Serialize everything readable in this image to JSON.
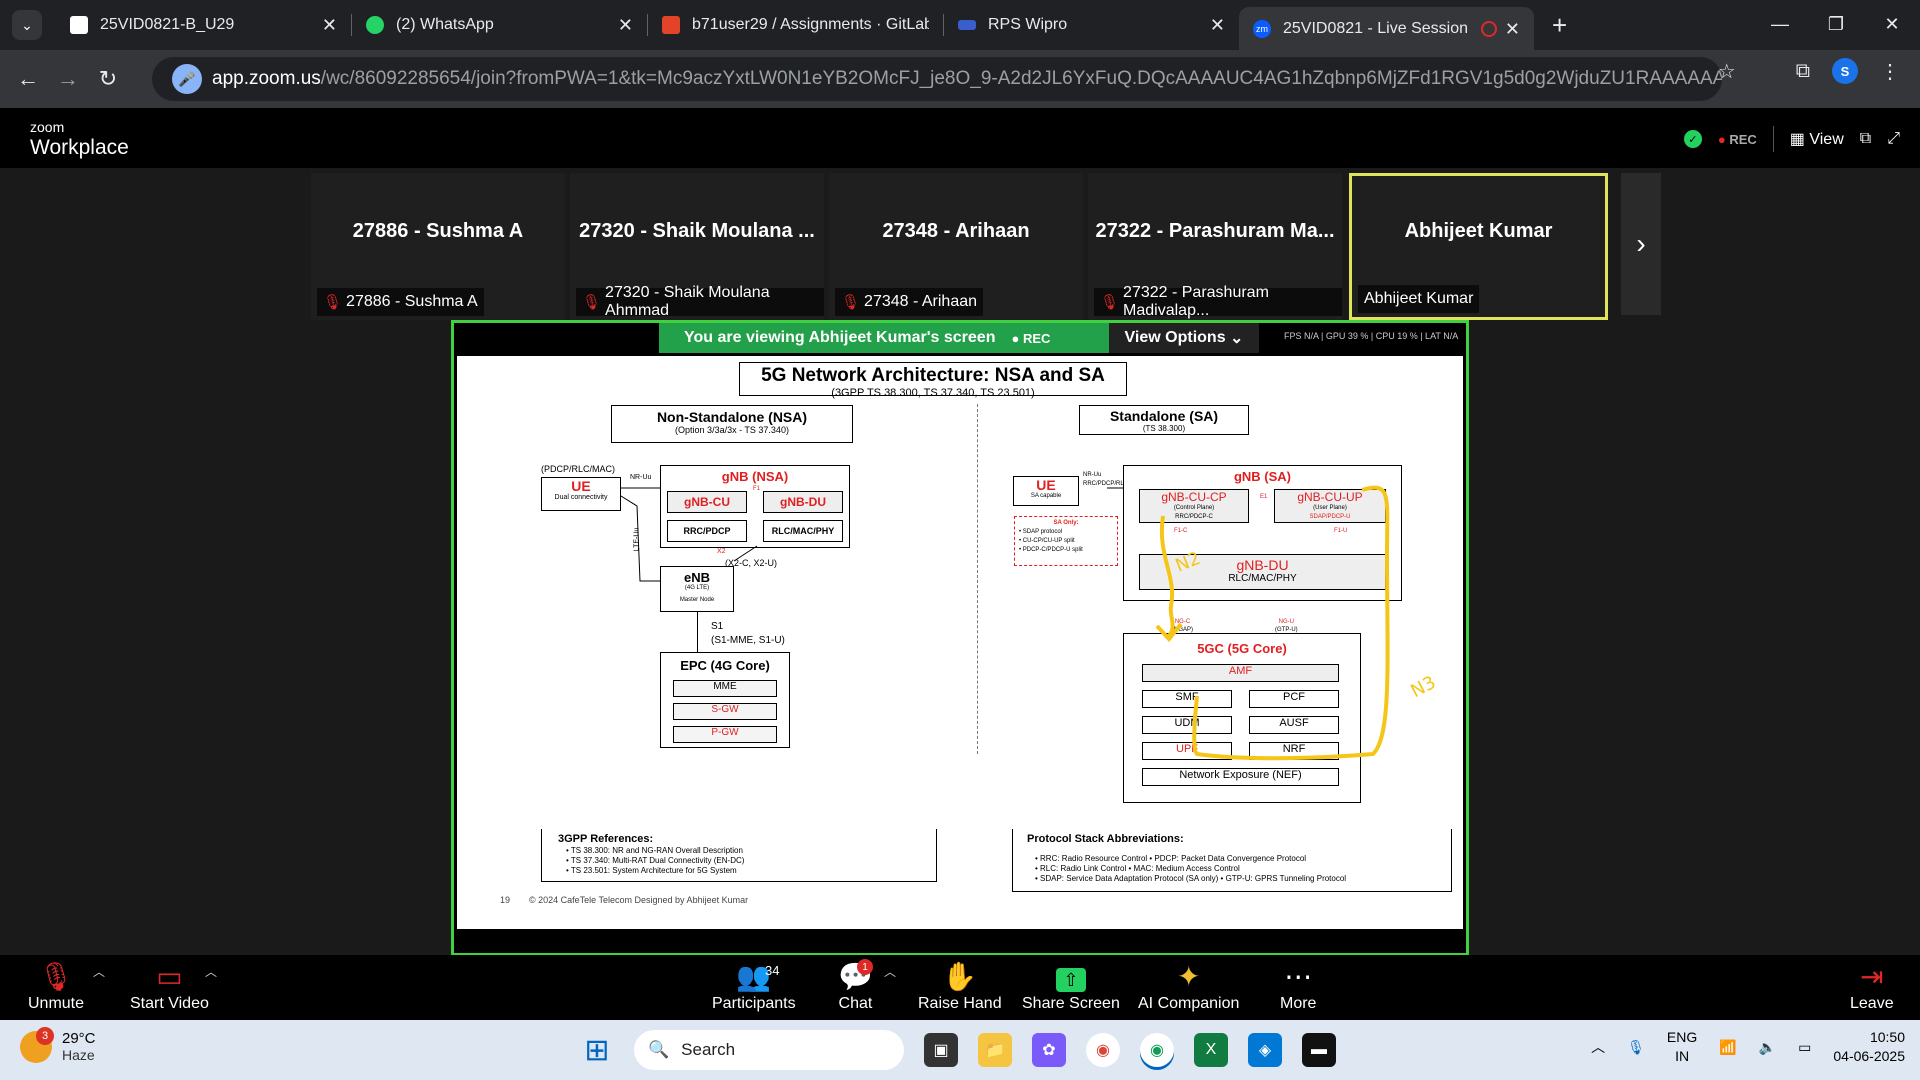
{
  "browser": {
    "tabs": [
      {
        "label": "25VID0821-B_U29"
      },
      {
        "label": "(2) WhatsApp"
      },
      {
        "label": "b71user29 / Assignments · GitLab"
      },
      {
        "label": "RPS Wipro"
      },
      {
        "label": "25VID0821 - Live Session"
      }
    ],
    "url_host": "app.zoom.us",
    "url_path": "/wc/86092285654/join?fromPWA=1&tk=Mc9aczYxtLW0N1eYB2OMcFJ_je8O_9-A2d2JL6YxFuQ.DQcAAAAUC4AG1hZqbnp6MjZFd1RGV1g5d0g2WjduZU1RAAAAAAAAAAAAAAAA...",
    "profile_initial": "S"
  },
  "zoom": {
    "logo_top": "zoom",
    "logo_bottom": "Workplace",
    "rec_label": "REC",
    "view_label": "View",
    "participants": [
      {
        "name": "27886 - Sushma A",
        "footer": "27886 - Sushma A"
      },
      {
        "name": "27320 - Shaik Moulana ...",
        "footer": "27320 - Shaik Moulana Ahmmad"
      },
      {
        "name": "27348 - Arihaan",
        "footer": "27348 - Arihaan"
      },
      {
        "name": "27322 - Parashuram Ma...",
        "footer": "27322 - Parashuram Madivalap..."
      },
      {
        "name": "Abhijeet Kumar",
        "footer": "Abhijeet Kumar"
      }
    ],
    "share_banner": "You are viewing  Abhijeet Kumar's screen",
    "share_rec": "REC",
    "view_options": "View Options",
    "stats": "FPS N/A  |  GPU 39 %  |  CPU 19 %  |  LAT N/A",
    "toolbar": {
      "unmute": "Unmute",
      "start_video": "Start Video",
      "participants": "Participants",
      "participants_count": "34",
      "chat": "Chat",
      "chat_badge": "1",
      "raise_hand": "Raise Hand",
      "share_screen": "Share Screen",
      "ai_companion": "AI Companion",
      "more": "More",
      "leave": "Leave"
    }
  },
  "slide": {
    "title": "5G Network Architecture: NSA and SA",
    "subtitle": "(3GPP TS 38.300, TS 37.340, TS 23.501)",
    "nsa": {
      "title": "Non-Standalone (NSA)",
      "subtitle": "(Option 3/3a/3x - TS 37.340)",
      "ue_top": "(PDCP/RLC/MAC)",
      "ue": "UE",
      "ue_sub": "Dual connectivity",
      "nr_uu": "NR-Uu",
      "lte_uu": "LTE-Uu",
      "gnb": "gNB (NSA)",
      "gnb_cu": "gNB-CU",
      "gnb_du": "gNB-DU",
      "f1": "F1",
      "rrc_pdcp": "RRC/PDCP",
      "rlc_mac": "RLC/MAC/PHY",
      "x2": "X2",
      "x2_label": "(X2-C, X2-U)",
      "enb": "eNB",
      "enb_sub1": "(4G LTE)",
      "enb_sub2": "Master Node",
      "s1": "S1",
      "s1_label": "(S1-MME, S1-U)",
      "epc": "EPC (4G Core)",
      "mme": "MME",
      "sgw": "S-GW",
      "pgw": "P-GW"
    },
    "sa": {
      "title": "Standalone (SA)",
      "subtitle": "(TS 38.300)",
      "ue": "UE",
      "ue_sub": "SA capable",
      "nr_uu": "NR-Uu",
      "nr_uu_sub": "RRC/PDCP/RLC...",
      "gnb": "gNB (SA)",
      "cu_cp": "gNB-CU-CP",
      "cu_cp_sub1": "(Control Plane)",
      "cu_cp_sub2": "RRC/PDCP-C",
      "e1": "E1",
      "cu_up": "gNB-CU-UP",
      "cu_up_sub1": "(User Plane)",
      "cu_up_sub2": "SDAP/PDCP-U",
      "f1c": "F1-C",
      "f1u": "F1-U",
      "du": "gNB-DU",
      "du_sub": "RLC/MAC/PHY",
      "sa_only_title": "SA Only:",
      "sa_only_items": [
        "• SDAP protocol",
        "• CU-CP/CU-UP split",
        "• PDCP-C/PDCP-U split"
      ],
      "ngc": "NG-C",
      "ngc_sub": "(NGAP)",
      "ngu": "NG-U",
      "ngu_sub": "(GTP-U)",
      "core": "5GC (5G Core)",
      "amf": "AMF",
      "smf": "SMF",
      "pcf": "PCF",
      "udm": "UDM",
      "ausf": "AUSF",
      "upf": "UPF",
      "nrf": "NRF",
      "nef": "Network Exposure (NEF)"
    },
    "refs_title": "3GPP References:",
    "refs": [
      "• TS 38.300: NR and NG-RAN Overall Description",
      "• TS 37.340: Multi-RAT Dual Connectivity (EN-DC)",
      "• TS 23.501: System Architecture for 5G System"
    ],
    "proto_title": "Protocol Stack Abbreviations:",
    "proto": [
      "• RRC: Radio Resource Control • PDCP: Packet Data Convergence Protocol",
      "• RLC: Radio Link Control • MAC: Medium Access Control",
      "• SDAP: Service Data Adaptation Protocol (SA only) • GTP-U: GPRS Tunneling Protocol"
    ],
    "page_num": "19",
    "footer": "© 2024 CafeTele Telecom Designed by Abhijeet Kumar",
    "hand_n2": "N2",
    "hand_n3": "N3"
  },
  "taskbar": {
    "weather_badge": "3",
    "temp": "29°C",
    "condition": "Haze",
    "search": "Search",
    "lang1": "ENG",
    "lang2": "IN",
    "time": "10:50",
    "date": "04-06-2025"
  }
}
